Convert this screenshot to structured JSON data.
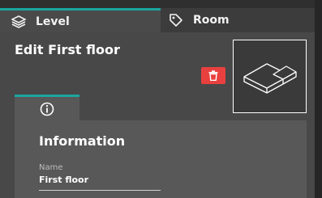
{
  "tabs": [
    {
      "label": "Level",
      "icon": "layers-icon",
      "active": true
    },
    {
      "label": "Room",
      "icon": "tag-icon",
      "active": false
    }
  ],
  "header": {
    "title": "Edit First floor"
  },
  "actions": {
    "delete_icon": "trash-icon"
  },
  "thumbnail": {
    "icon": "floor-plan-3d-icon"
  },
  "subtabs": [
    {
      "icon": "info-icon",
      "active": true
    }
  ],
  "section": {
    "title": "Information"
  },
  "fields": {
    "name": {
      "label": "Name",
      "value": "First floor"
    }
  },
  "colors": {
    "accent": "#1aa6a0",
    "danger": "#e8403f",
    "panel": "#484848",
    "card": "#585858",
    "background": "#2f2f2f"
  }
}
